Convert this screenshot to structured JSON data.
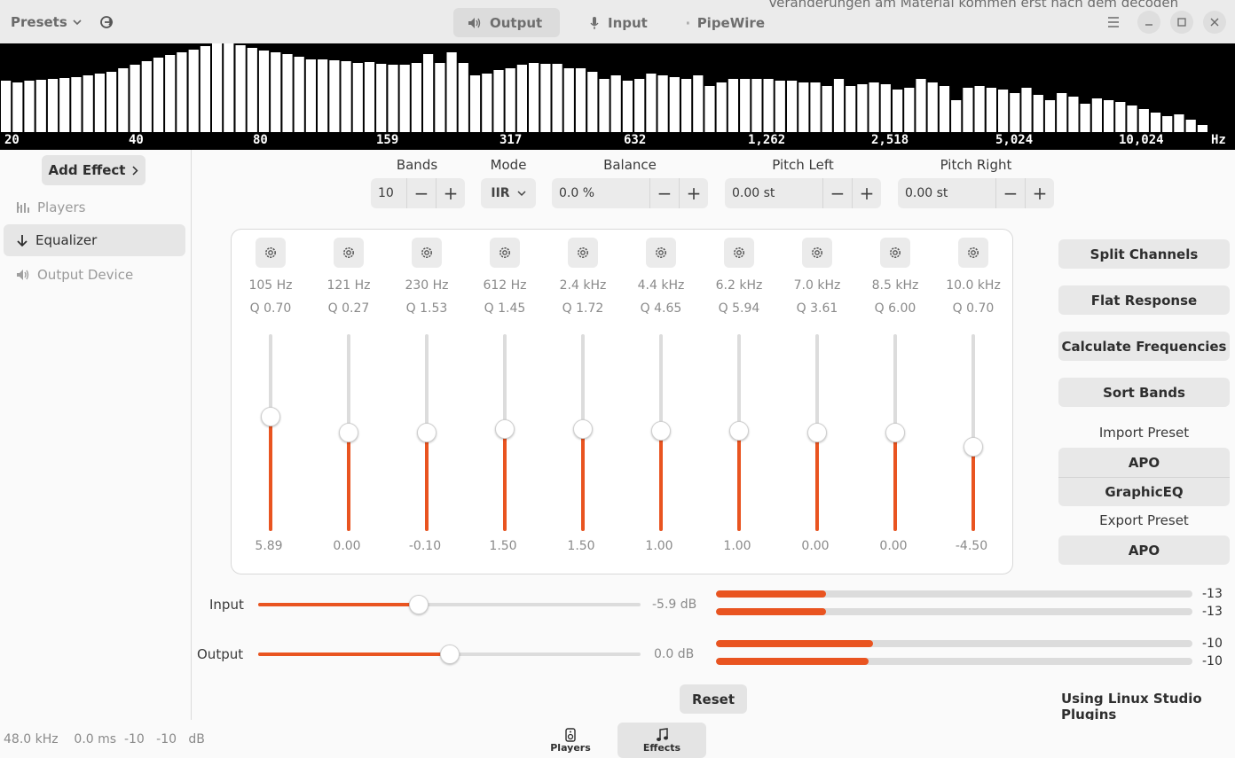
{
  "header": {
    "presets_label": "Presets",
    "tabs": [
      {
        "label": "Output",
        "icon": "speaker-icon",
        "active": true
      },
      {
        "label": "Input",
        "icon": "microphone-icon"
      },
      {
        "label": "PipeWire",
        "icon": "pipewire-icon"
      }
    ],
    "overflow_text": "Veränderungen am Material kommen erst nach dem decoden"
  },
  "spectrum": {
    "ticks": [
      "20",
      "40",
      "80",
      "159",
      "317",
      "632",
      "1,262",
      "2,518",
      "5,024",
      "10,024",
      "Hz"
    ],
    "levels": [
      0.58,
      0.56,
      0.58,
      0.59,
      0.6,
      0.61,
      0.62,
      0.64,
      0.66,
      0.68,
      0.72,
      0.76,
      0.8,
      0.84,
      0.87,
      0.9,
      0.93,
      0.97,
      1.0,
      1.0,
      0.98,
      0.95,
      0.92,
      0.9,
      0.88,
      0.85,
      0.82,
      0.82,
      0.81,
      0.8,
      0.78,
      0.79,
      0.77,
      0.76,
      0.76,
      0.78,
      0.88,
      0.78,
      0.9,
      0.78,
      0.64,
      0.66,
      0.7,
      0.72,
      0.76,
      0.78,
      0.77,
      0.77,
      0.72,
      0.72,
      0.68,
      0.6,
      0.64,
      0.58,
      0.6,
      0.66,
      0.64,
      0.62,
      0.6,
      0.64,
      0.52,
      0.56,
      0.6,
      0.6,
      0.6,
      0.6,
      0.58,
      0.58,
      0.56,
      0.56,
      0.52,
      0.6,
      0.52,
      0.54,
      0.56,
      0.54,
      0.48,
      0.5,
      0.6,
      0.56,
      0.52,
      0.36,
      0.5,
      0.52,
      0.5,
      0.48,
      0.44,
      0.5,
      0.42,
      0.36,
      0.44,
      0.4,
      0.32,
      0.38,
      0.36,
      0.34,
      0.3,
      0.26,
      0.22,
      0.18,
      0.2,
      0.14,
      0.08
    ]
  },
  "sidebar": {
    "add_effect": "Add Effect",
    "items": [
      {
        "label": "Players",
        "icon": "players-icon"
      },
      {
        "label": "Equalizer",
        "icon": "arrow-down-icon",
        "selected": true
      },
      {
        "label": "Output Device",
        "icon": "speaker-icon"
      }
    ]
  },
  "controls": {
    "bands_label": "Bands",
    "bands_value": "10",
    "mode_label": "Mode",
    "mode_value": "IIR",
    "balance_label": "Balance",
    "balance_value": "0.0 %",
    "pitch_left_label": "Pitch Left",
    "pitch_left_value": "0.00 st",
    "pitch_right_label": "Pitch Right",
    "pitch_right_value": "0.00 st"
  },
  "bands": [
    {
      "freq": "105 Hz",
      "q": "Q 0.70",
      "gain": "5.89",
      "level": 0.58
    },
    {
      "freq": "121 Hz",
      "q": "Q 0.27",
      "gain": "0.00",
      "level": 0.5
    },
    {
      "freq": "230 Hz",
      "q": "Q 1.53",
      "gain": "-0.10",
      "level": 0.5
    },
    {
      "freq": "612 Hz",
      "q": "Q 1.45",
      "gain": "1.50",
      "level": 0.52
    },
    {
      "freq": "2.4 kHz",
      "q": "Q 1.72",
      "gain": "1.50",
      "level": 0.52
    },
    {
      "freq": "4.4 kHz",
      "q": "Q 4.65",
      "gain": "1.00",
      "level": 0.51
    },
    {
      "freq": "6.2 kHz",
      "q": "Q 5.94",
      "gain": "1.00",
      "level": 0.51
    },
    {
      "freq": "7.0 kHz",
      "q": "Q 3.61",
      "gain": "0.00",
      "level": 0.5
    },
    {
      "freq": "8.5 kHz",
      "q": "Q 6.00",
      "gain": "0.00",
      "level": 0.5
    },
    {
      "freq": "10.0 kHz",
      "q": "Q 0.70",
      "gain": "-4.50",
      "level": 0.43
    }
  ],
  "right_panel": {
    "split_channels": "Split Channels",
    "flat_response": "Flat Response",
    "calculate_frequencies": "Calculate Frequencies",
    "sort_bands": "Sort Bands",
    "import_preset": "Import Preset",
    "import_apo": "APO",
    "import_graphiceq": "GraphicEQ",
    "export_preset": "Export Preset",
    "export_apo": "APO"
  },
  "gain": {
    "input_label": "Input",
    "input_db": "-5.9 dB",
    "input_level": 0.42,
    "output_label": "Output",
    "output_db": "0.0 dB",
    "output_level": 0.5,
    "input_meters": [
      {
        "value": "-13",
        "level": 0.23
      },
      {
        "value": "-13",
        "level": 0.23
      }
    ],
    "output_meters": [
      {
        "value": "-10",
        "level": 0.33
      },
      {
        "value": "-10",
        "level": 0.32
      }
    ]
  },
  "reset_label": "Reset",
  "plugins_label": "Using Linux Studio Plugins",
  "status": "48.0 kHz    0.0 ms  -10   -10   dB",
  "footer": {
    "players": "Players",
    "effects": "Effects"
  }
}
